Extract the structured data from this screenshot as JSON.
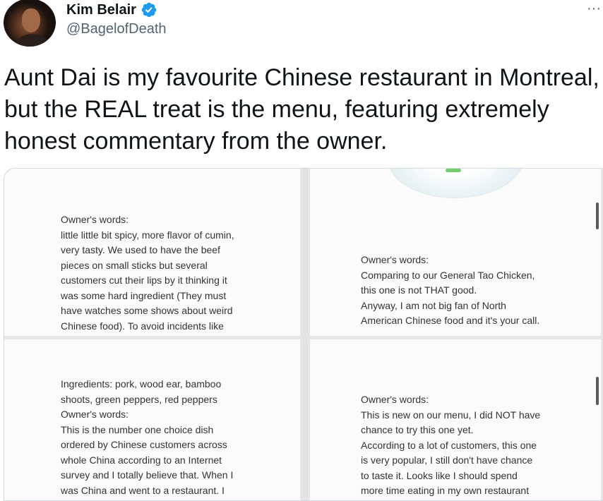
{
  "tweet": {
    "author": {
      "display_name": "Kim Belair",
      "handle": "@BagelofDeath",
      "verified": true,
      "verified_color": "#1d9bf0"
    },
    "menu_icon": "more-horizontal-icon",
    "text": "Aunt Dai is my favourite Chinese restaurant in Montreal, but the REAL treat is the menu, featuring extremely honest commentary from the owner."
  },
  "media": {
    "top_left": {
      "lines": [
        "Owner's words:",
        "little little bit spicy, more flavor of cumin,",
        "very tasty. We used to have the beef",
        "pieces on small sticks but several",
        "customers cut their lips by it thinking it",
        "was some hard ingredient (They must",
        "have watches some shows about weird",
        "Chinese food). To avoid incidents like"
      ]
    },
    "top_right": {
      "lines": [
        "Owner's words:",
        "Comparing to our General Tao Chicken,",
        "this one is not THAT good.",
        "Anyway, I am not big fan of North",
        "American Chinese food and it's your call."
      ]
    },
    "bottom_left": {
      "lines": [
        "Ingredients: pork, wood ear, bamboo",
        "shoots, green peppers, red peppers",
        "Owner's words:",
        "This is the number one choice dish",
        "ordered by Chinese customers across",
        "whole China according to an Internet",
        "survey and I totally believe that. When I",
        "was China and went to a restaurant. I"
      ]
    },
    "bottom_right": {
      "lines": [
        "Owner's words:",
        "This is new on our menu, I did NOT have",
        "chance to try this one yet.",
        "According to a lot of customers, this one",
        "is very popular, I still don't have chance",
        "to taste it. Looks like I should spend",
        "more time eating in my own restaurant"
      ]
    }
  }
}
